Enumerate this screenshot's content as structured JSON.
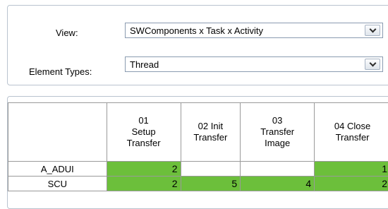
{
  "filters": {
    "view_label": "View:",
    "view_value": "SWComponents x Task x Activity",
    "element_types_label": "Element Types:",
    "element_types_value": "Thread",
    "dropdown_icon": "chevron-down-icon"
  },
  "grid": {
    "columns": [
      "01\nSetup\nTransfer",
      "02 Init\nTransfer",
      "03\nTransfer\nImage",
      "04 Close\nTransfer"
    ],
    "rows": [
      {
        "label": "A_ADUI",
        "cells": [
          "2",
          "",
          "",
          "1"
        ]
      },
      {
        "label": "SCU",
        "cells": [
          "2",
          "5",
          "4",
          "2"
        ]
      }
    ],
    "colors": {
      "filled": "#6cbf3b",
      "empty": "#ffffff",
      "border": "#9a9a9a"
    }
  }
}
